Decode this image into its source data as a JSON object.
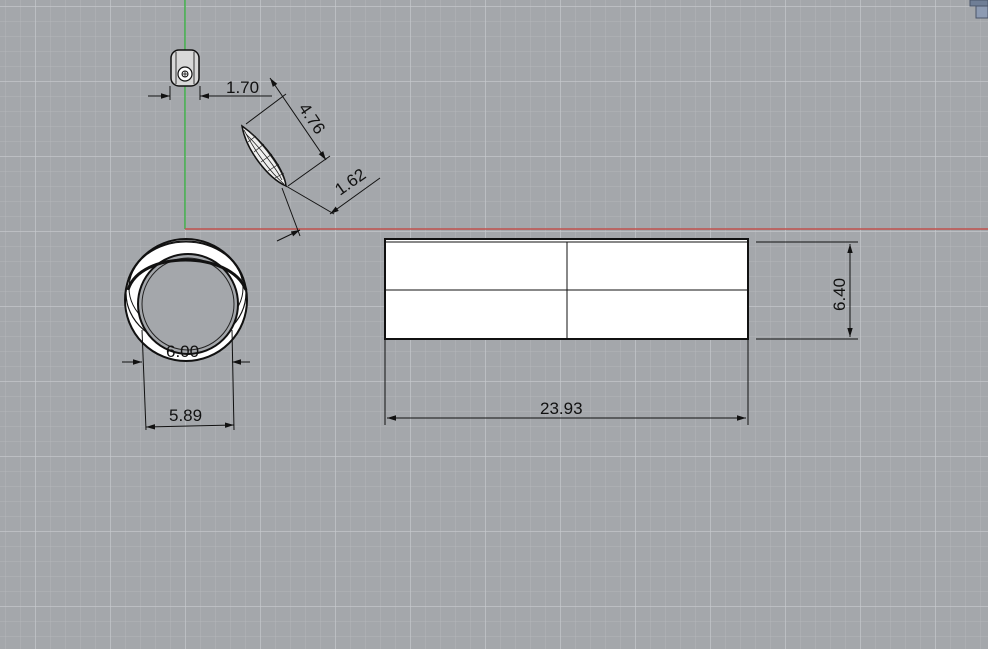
{
  "viewport": {
    "background": "#a4a7ab",
    "x_axis_color": "#c0504d",
    "y_axis_color": "#3fae49",
    "geometry_fill": "#ffffff",
    "line_color": "#111111"
  },
  "dimensions": {
    "pin_width": "1.70",
    "leaf_length": "4.76",
    "leaf_width": "1.62",
    "ring_inner": "6.00",
    "ring_width": "5.89",
    "band_length": "23.93",
    "band_height": "6.40"
  },
  "icons": {
    "gizmo": "viewport-gizmo-icon"
  }
}
